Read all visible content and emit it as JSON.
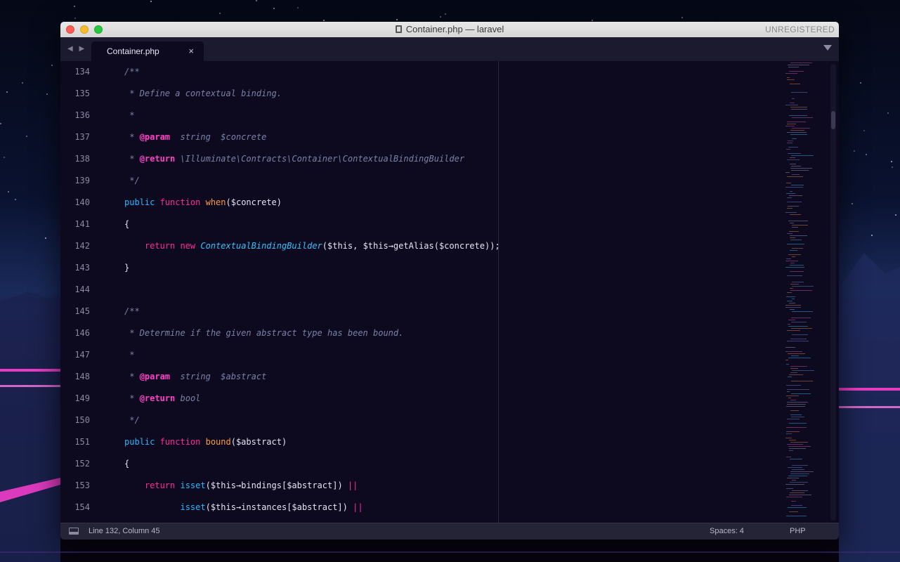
{
  "window": {
    "title": "Container.php — laravel",
    "registration": "UNREGISTERED"
  },
  "tab": {
    "label": "Container.php",
    "close": "×"
  },
  "nav": {
    "arrows": "◀ ▶"
  },
  "editor": {
    "line_numbers": [
      "134",
      "135",
      "136",
      "137",
      "138",
      "139",
      "140",
      "141",
      "142",
      "143",
      "144",
      "145",
      "146",
      "147",
      "148",
      "149",
      "150",
      "151",
      "152",
      "153",
      "154"
    ],
    "lines": [
      [
        {
          "t": "/**",
          "s": "c"
        }
      ],
      [
        {
          "t": " * Define a contextual binding.",
          "s": "c"
        }
      ],
      [
        {
          "t": " *",
          "s": "c"
        }
      ],
      [
        {
          "t": " * ",
          "s": "c"
        },
        {
          "t": "@param",
          "s": "tag"
        },
        {
          "t": "  string  $concrete",
          "s": "ital"
        }
      ],
      [
        {
          "t": " * ",
          "s": "c"
        },
        {
          "t": "@return",
          "s": "tag"
        },
        {
          "t": " \\Illuminate\\Contracts\\Container\\ContextualBindingBuilder",
          "s": "ital"
        }
      ],
      [
        {
          "t": " */",
          "s": "c"
        }
      ],
      [
        {
          "t": "public ",
          "s": "dec"
        },
        {
          "t": "function ",
          "s": "kw"
        },
        {
          "t": "when",
          "s": "fn"
        },
        {
          "t": "($concrete)",
          "s": ""
        }
      ],
      [
        {
          "t": "{",
          "s": ""
        }
      ],
      [
        {
          "t": "    return ",
          "s": "kw"
        },
        {
          "t": "new ",
          "s": "kw"
        },
        {
          "t": "ContextualBindingBuilder",
          "s": "cls"
        },
        {
          "t": "($this, $this→getAlias($concrete));",
          "s": ""
        }
      ],
      [
        {
          "t": "}",
          "s": ""
        }
      ],
      [
        {
          "t": "",
          "s": ""
        }
      ],
      [
        {
          "t": "/**",
          "s": "c"
        }
      ],
      [
        {
          "t": " * Determine if the given abstract type has been bound.",
          "s": "c"
        }
      ],
      [
        {
          "t": " *",
          "s": "c"
        }
      ],
      [
        {
          "t": " * ",
          "s": "c"
        },
        {
          "t": "@param",
          "s": "tag"
        },
        {
          "t": "  string  $abstract",
          "s": "ital"
        }
      ],
      [
        {
          "t": " * ",
          "s": "c"
        },
        {
          "t": "@return",
          "s": "tag"
        },
        {
          "t": " bool",
          "s": "ital"
        }
      ],
      [
        {
          "t": " */",
          "s": "c"
        }
      ],
      [
        {
          "t": "public ",
          "s": "dec"
        },
        {
          "t": "function ",
          "s": "kw"
        },
        {
          "t": "bound",
          "s": "fn"
        },
        {
          "t": "($abstract)",
          "s": ""
        }
      ],
      [
        {
          "t": "{",
          "s": ""
        }
      ],
      [
        {
          "t": "    return ",
          "s": "kw"
        },
        {
          "t": "isset",
          "s": "dec"
        },
        {
          "t": "($this→bindings[$abstract]) ",
          "s": ""
        },
        {
          "t": "||",
          "s": "kw"
        }
      ],
      [
        {
          "t": "           isset",
          "s": "dec"
        },
        {
          "t": "($this→instances[$abstract]) ",
          "s": ""
        },
        {
          "t": "||",
          "s": "kw"
        }
      ]
    ]
  },
  "status": {
    "position": "Line 132, Column 45",
    "indentation": "Spaces: 4",
    "syntax": "PHP"
  },
  "colors": {
    "background": "#0d0a1f",
    "keyword": "#ff2a9a",
    "declaration": "#27b8ff",
    "function": "#ff9b3d",
    "comment": "#7a82a8",
    "doctag": "#ff40c8"
  }
}
